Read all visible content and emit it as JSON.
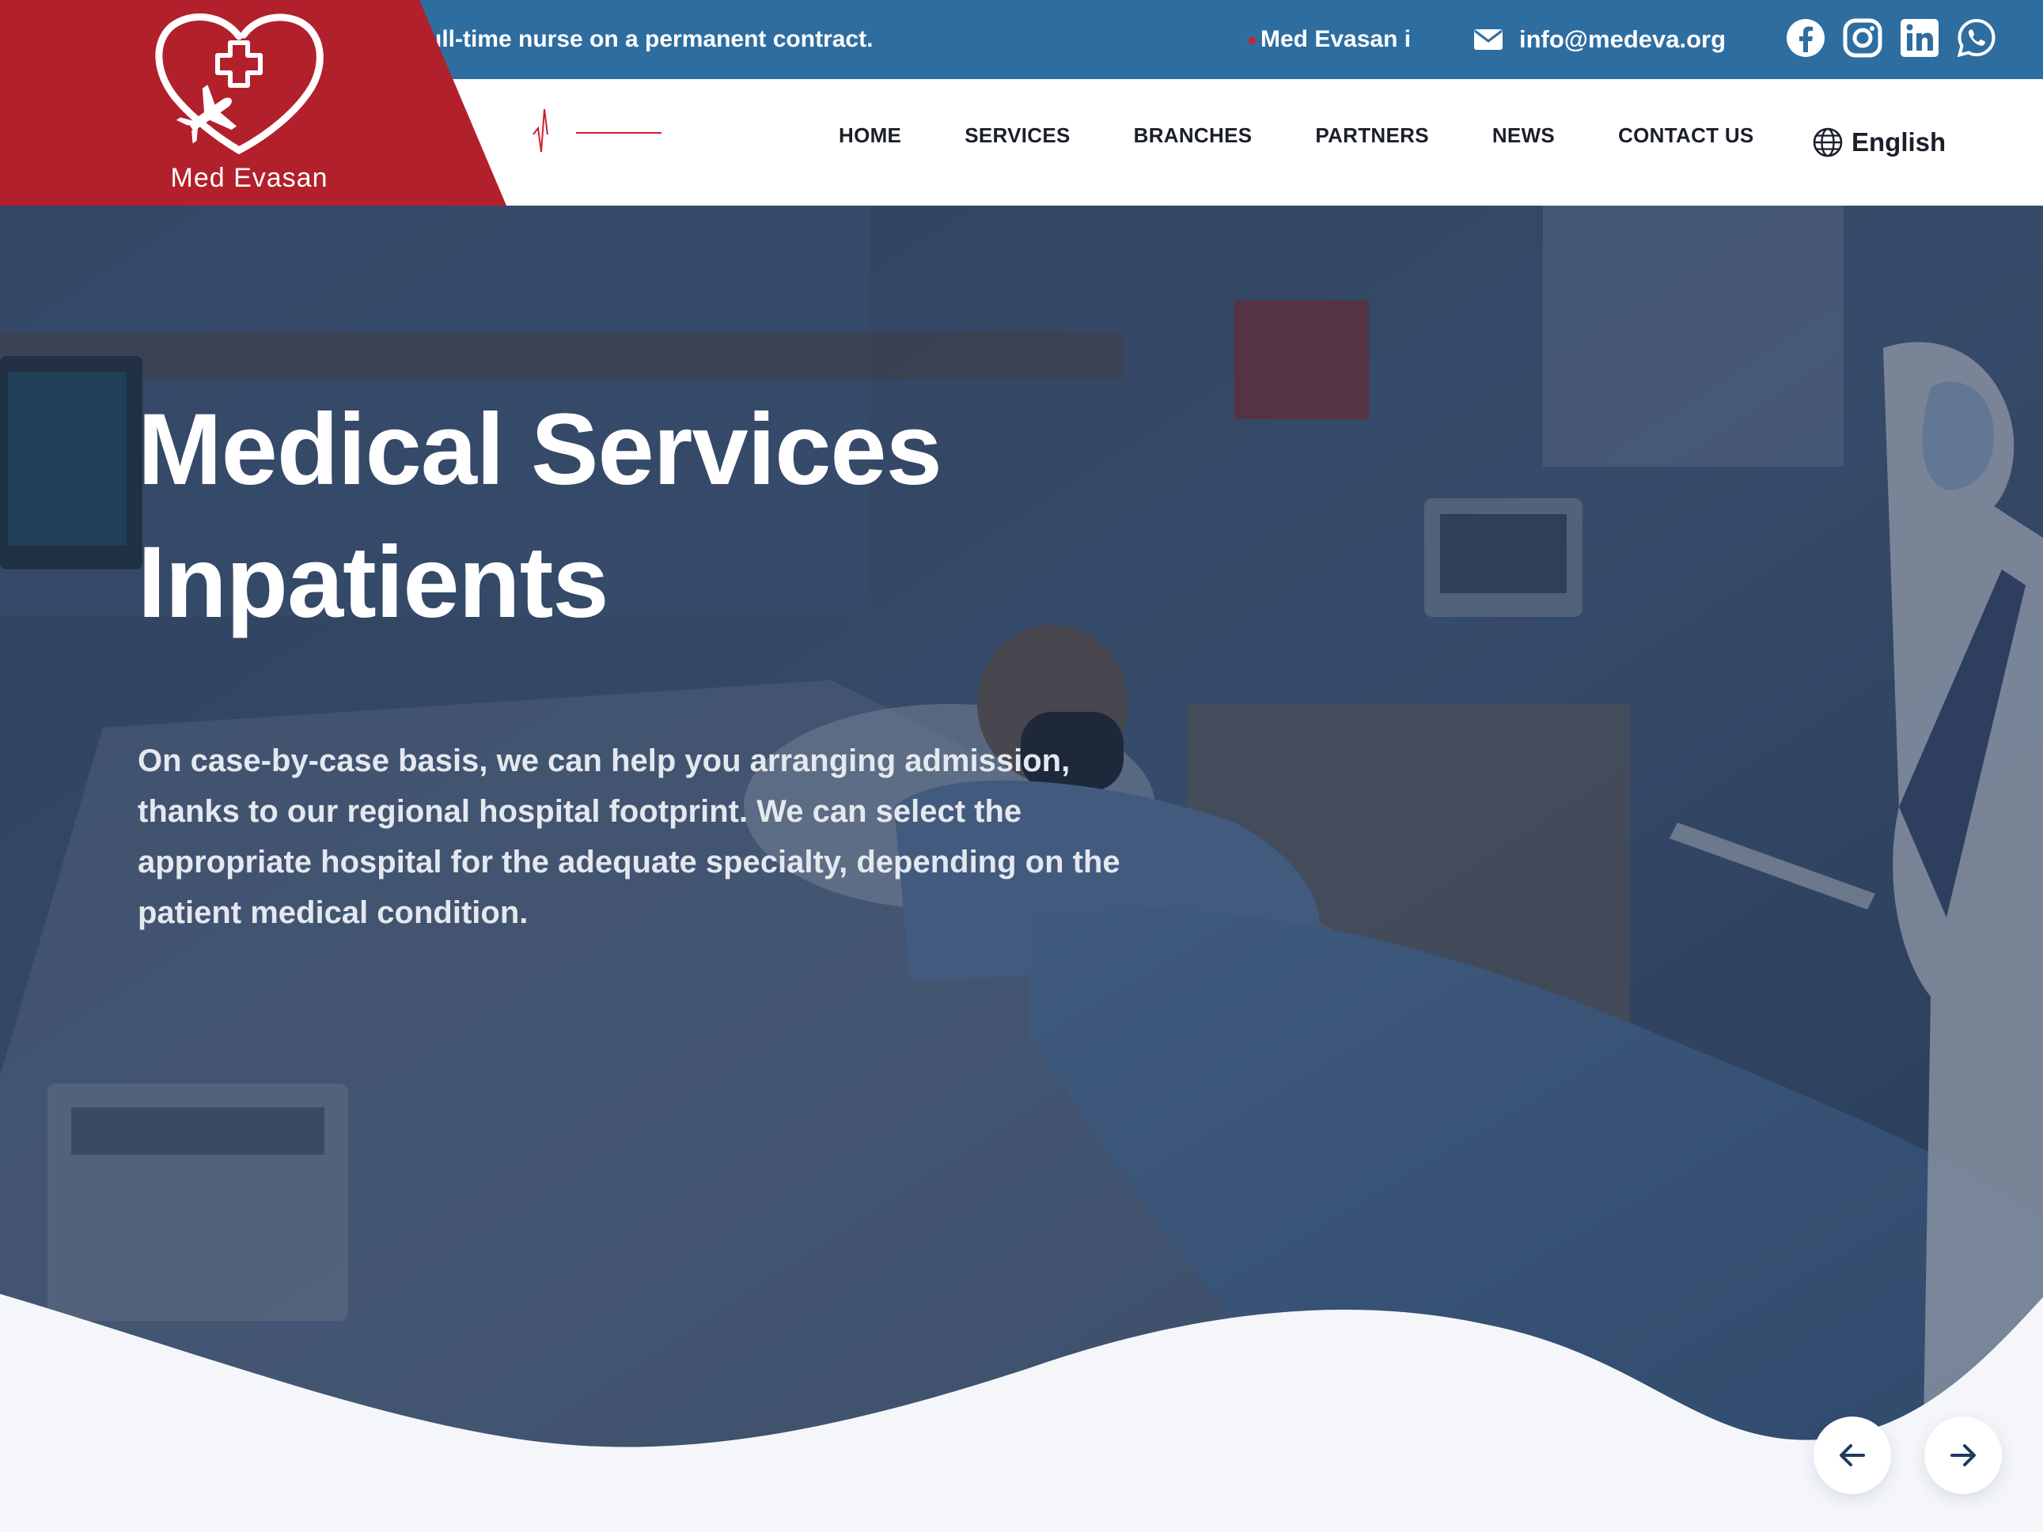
{
  "topbar": {
    "ticker_left": "ull-time nurse on a permanent contract.",
    "ticker_right": "Med Evasan i",
    "email": "info@medeva.org",
    "social_icons": [
      "facebook-icon",
      "instagram-icon",
      "linkedin-icon",
      "whatsapp-icon"
    ]
  },
  "brand": {
    "name": "Med Evasan",
    "logo_icon": "heart-cross-plane-logo"
  },
  "nav": {
    "items": [
      {
        "label": "HOME"
      },
      {
        "label": "SERVICES"
      },
      {
        "label": "BRANCHES"
      },
      {
        "label": "PARTNERS"
      },
      {
        "label": "NEWS"
      },
      {
        "label": "CONTACT US"
      }
    ],
    "language": "English"
  },
  "hero": {
    "title_line1": "Medical Services",
    "title_line2": "Inpatients",
    "description": "On case-by-case basis, we can help you arranging admission, thanks to our regional hospital footprint. We can select the appropriate hospital for the adequate specialty, depending on the patient medical condition."
  },
  "slider": {
    "prev_icon": "arrow-left-icon",
    "next_icon": "arrow-right-icon"
  },
  "colors": {
    "topbar": "#2e6da0",
    "brand_red": "#b2202b",
    "accent_red": "#d21f2b",
    "text_dark": "#1b1f29",
    "page_bg": "#f4f6fa",
    "arrow": "#1e3a5f"
  }
}
